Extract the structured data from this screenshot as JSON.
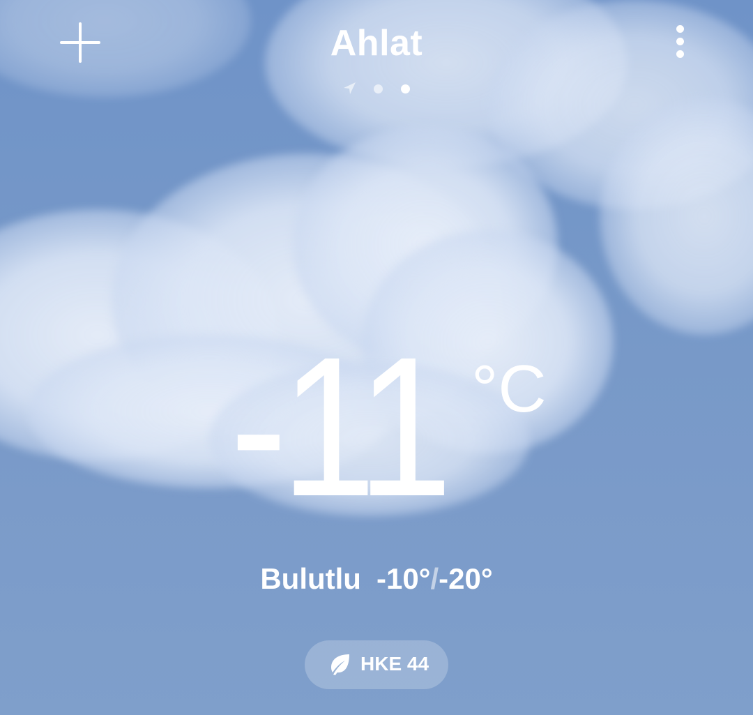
{
  "header": {
    "city": "Ahlat",
    "add_icon": "plus-icon",
    "menu_icon": "more-vertical-icon",
    "page_indicators": [
      "location-arrow-icon",
      "dot",
      "dot-active"
    ]
  },
  "current": {
    "temperature": "-11",
    "unit": "°C",
    "condition": "Bulutlu",
    "high": "-10°",
    "separator": "/",
    "low": "-20°"
  },
  "air_quality": {
    "icon": "leaf-icon",
    "label": "HKE 44"
  },
  "colors": {
    "sky": "#7698c8",
    "cloud": "#e3eaf6",
    "text": "#ffffff"
  }
}
